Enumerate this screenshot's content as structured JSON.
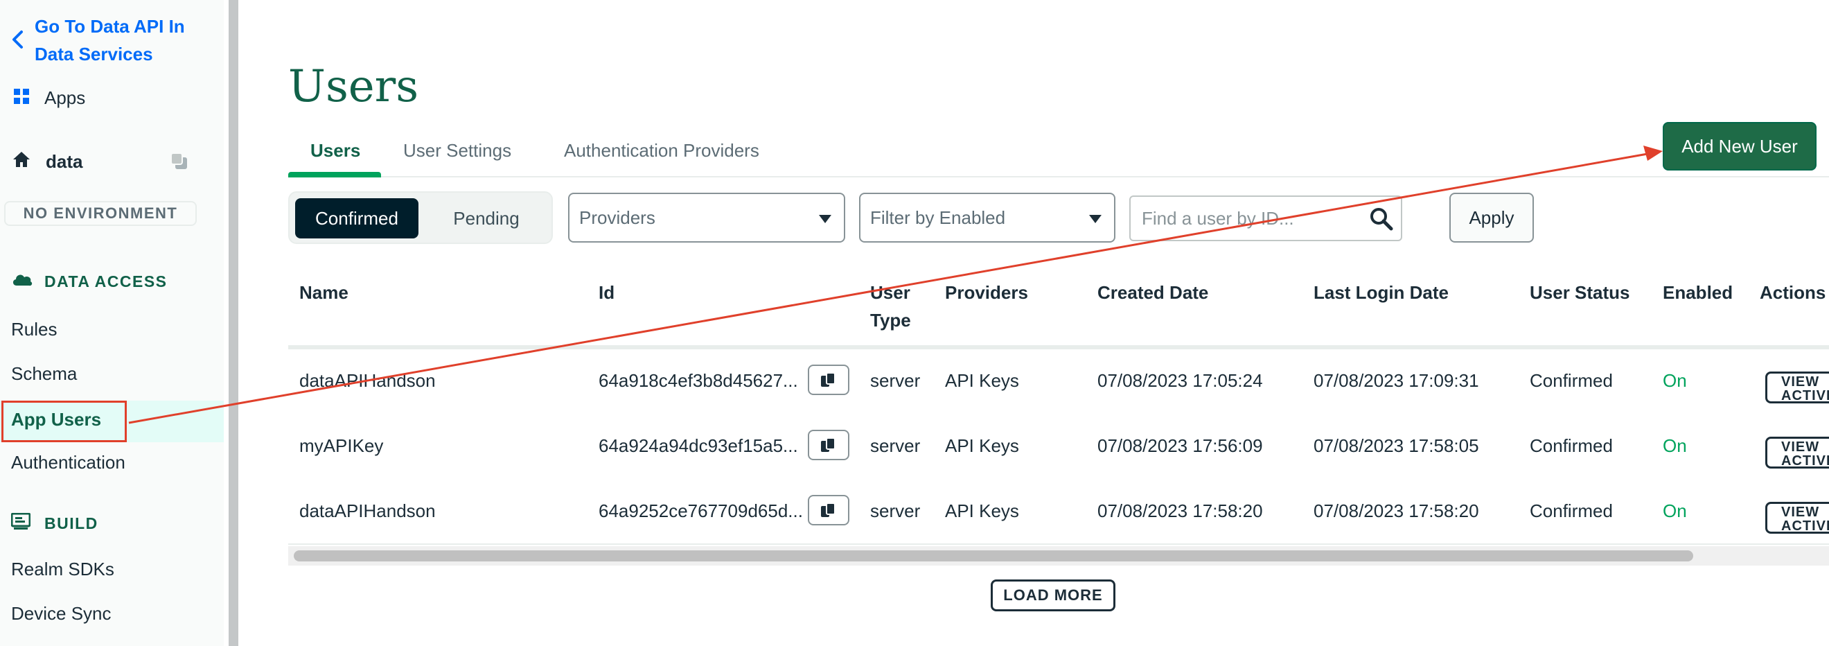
{
  "sidebar": {
    "back_link": "Go To Data API In Data Services",
    "apps_label": "Apps",
    "app_name": "data",
    "environment": "NO ENVIRONMENT",
    "data_access_heading": "DATA ACCESS",
    "data_access_items": [
      "Rules",
      "Schema",
      "App Users",
      "Authentication"
    ],
    "active_item": "App Users",
    "build_heading": "BUILD",
    "build_items": [
      "Realm SDKs",
      "Device Sync"
    ]
  },
  "page": {
    "title": "Users",
    "tabs": [
      "Users",
      "User Settings",
      "Authentication Providers"
    ],
    "active_tab": "Users",
    "add_user_label": "Add New User"
  },
  "filters": {
    "segments": [
      "Confirmed",
      "Pending"
    ],
    "selected_segment": "Confirmed",
    "providers_placeholder": "Providers",
    "enabled_placeholder": "Filter by Enabled",
    "search_placeholder": "Find a user by ID...",
    "apply_label": "Apply"
  },
  "table": {
    "columns": [
      "Name",
      "Id",
      "User Type",
      "Providers",
      "Created Date",
      "Last Login Date",
      "User Status",
      "Enabled",
      "Actions"
    ],
    "rows": [
      {
        "name": "dataAPIHandson",
        "id": "64a918c4ef3b8d45627...",
        "type": "server",
        "providers": "API Keys",
        "created": "07/08/2023 17:05:24",
        "last_login": "07/08/2023 17:09:31",
        "status": "Confirmed",
        "enabled": "On",
        "action": "VIEW ACTIVITY"
      },
      {
        "name": "myAPIKey",
        "id": "64a924a94dc93ef15a5...",
        "type": "server",
        "providers": "API Keys",
        "created": "07/08/2023 17:56:09",
        "last_login": "07/08/2023 17:58:05",
        "status": "Confirmed",
        "enabled": "On",
        "action": "VIEW ACTIVITY"
      },
      {
        "name": "dataAPIHandson",
        "id": "64a9252ce767709d65d...",
        "type": "server",
        "providers": "API Keys",
        "created": "07/08/2023 17:58:20",
        "last_login": "07/08/2023 17:58:20",
        "status": "Confirmed",
        "enabled": "On",
        "action": "VIEW ACTIVITY"
      }
    ],
    "load_more_label": "LOAD MORE"
  },
  "colors": {
    "brand_green": "#116149",
    "button_green": "#1e6b47",
    "annotation_red": "#e0402b",
    "link_blue": "#016bf8",
    "enabled_green": "#00a35c"
  },
  "icons": [
    "chevron-left-icon",
    "apps-grid-icon",
    "home-icon",
    "copy-icon",
    "cloud-icon",
    "build-icon",
    "caret-down-icon",
    "search-icon"
  ]
}
